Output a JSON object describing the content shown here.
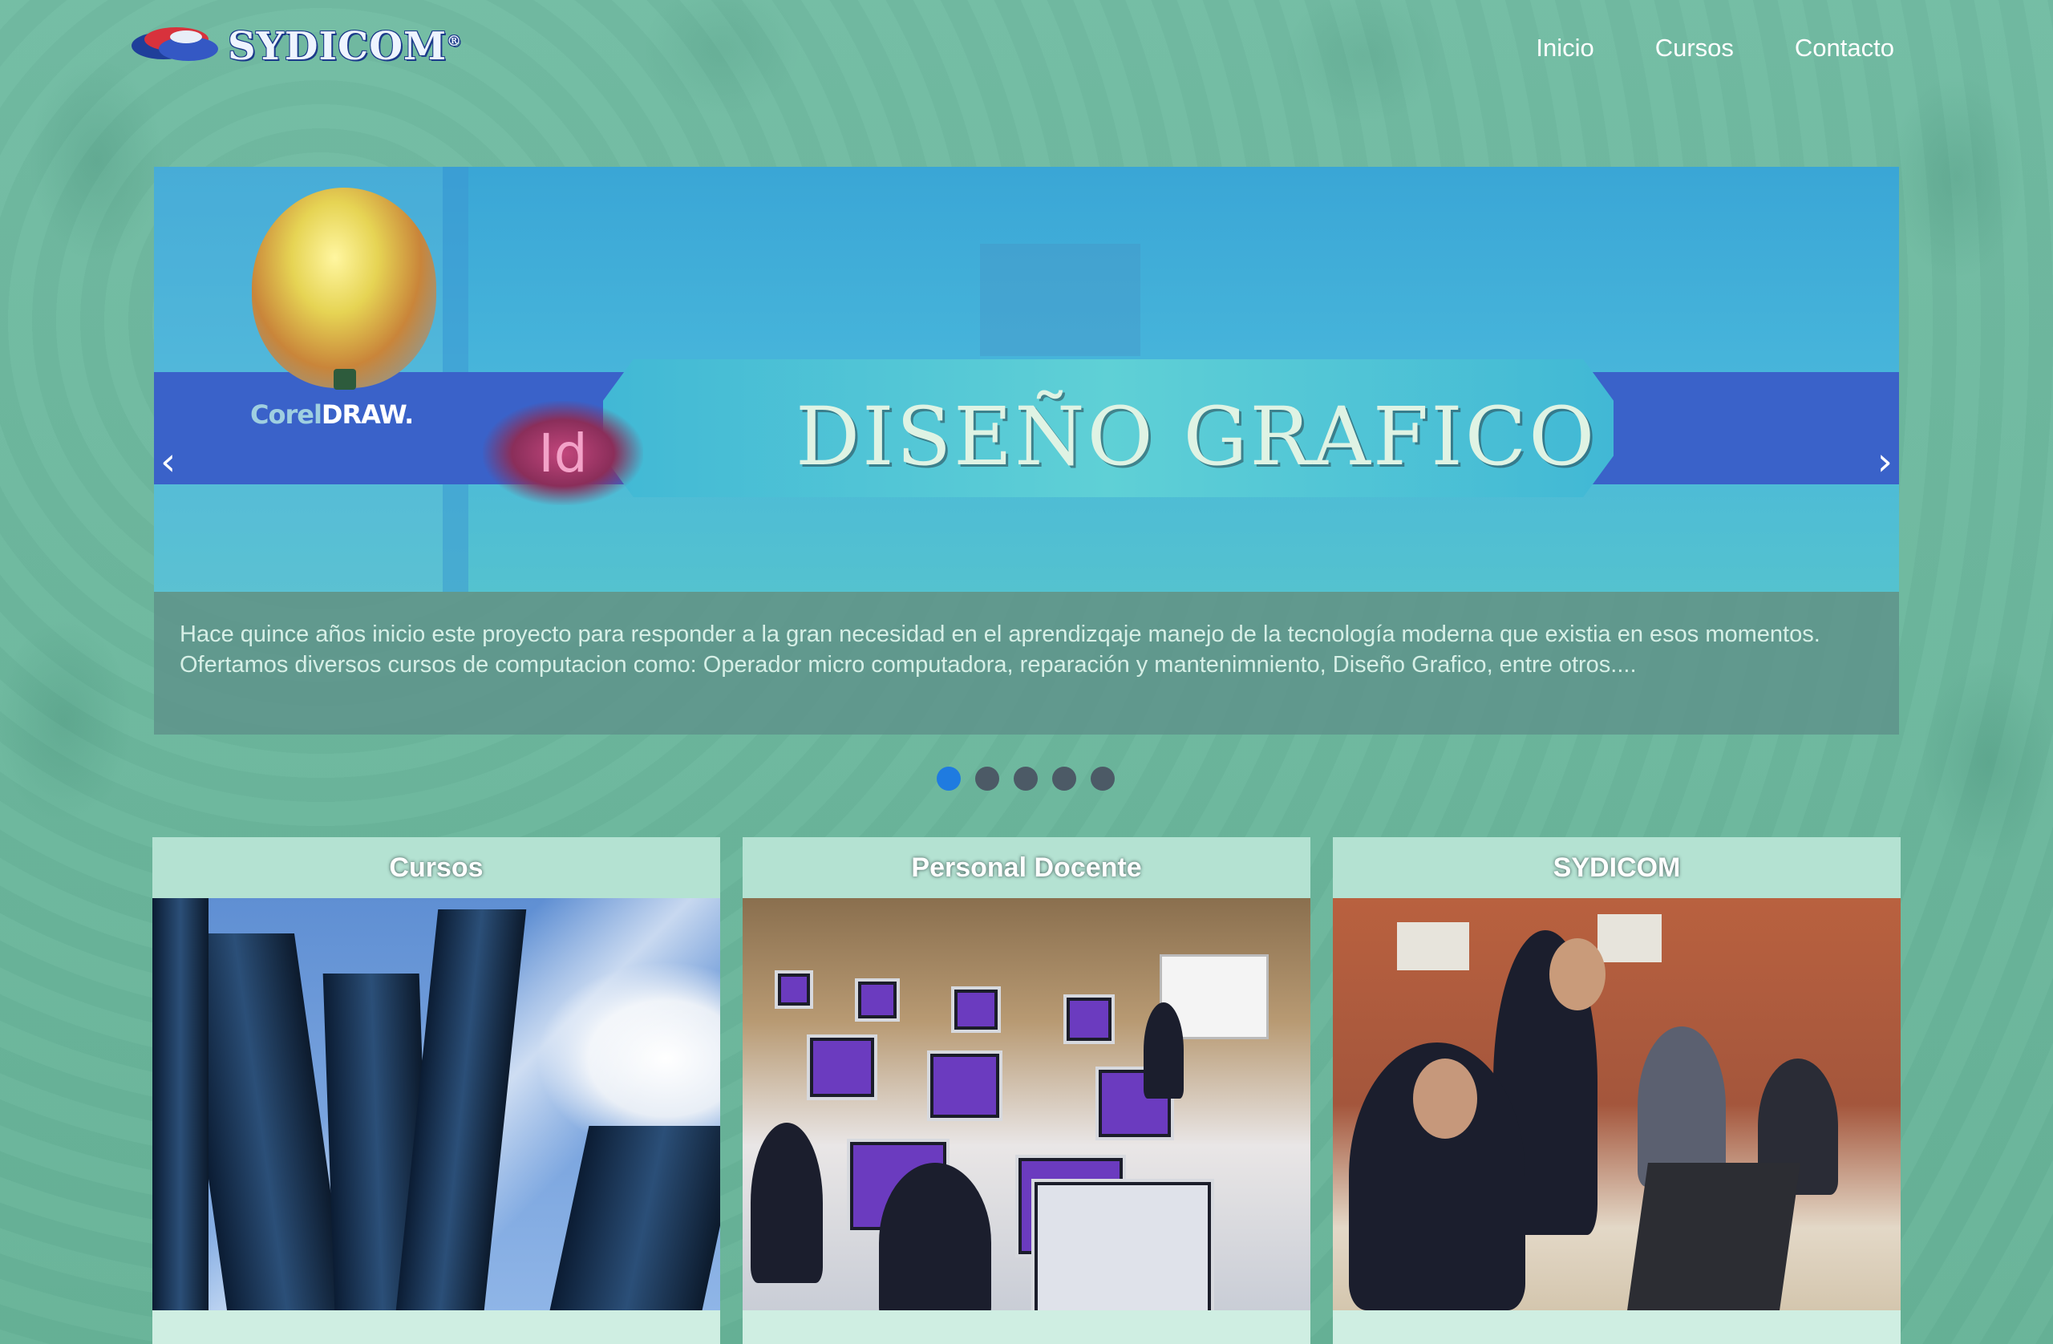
{
  "header": {
    "logo_text": "SYDICOM",
    "logo_mark": "®",
    "nav": [
      "Inicio",
      "Cursos",
      "Contacto"
    ]
  },
  "carousel": {
    "slide_title": "DISEÑO GRAFICO",
    "corel_prefix": "Corel",
    "corel_suffix": "DRAW.",
    "id_icon_text": "Id",
    "caption": "Hace quince años inicio este proyecto para responder a la gran necesidad en el aprendizqaje manejo de la tecnología moderna que existia en esos momentos. Ofertamos diversos cursos de computacion como: Operador micro computadora, reparación y mantenimniento, Diseño Grafico, entre otros....",
    "prev": "‹",
    "next": "›",
    "dot_count": 5,
    "active_dot": 1
  },
  "cards": [
    {
      "title": "Cursos"
    },
    {
      "title": "Personal Docente"
    },
    {
      "title": "SYDICOM"
    }
  ],
  "colors": {
    "background": "#6fb9a0",
    "active_dot": "#1f7be0",
    "inactive_dot": "#4c5a66"
  },
  "icons": {
    "prev": "chevron-left-icon",
    "next": "chevron-right-icon"
  }
}
